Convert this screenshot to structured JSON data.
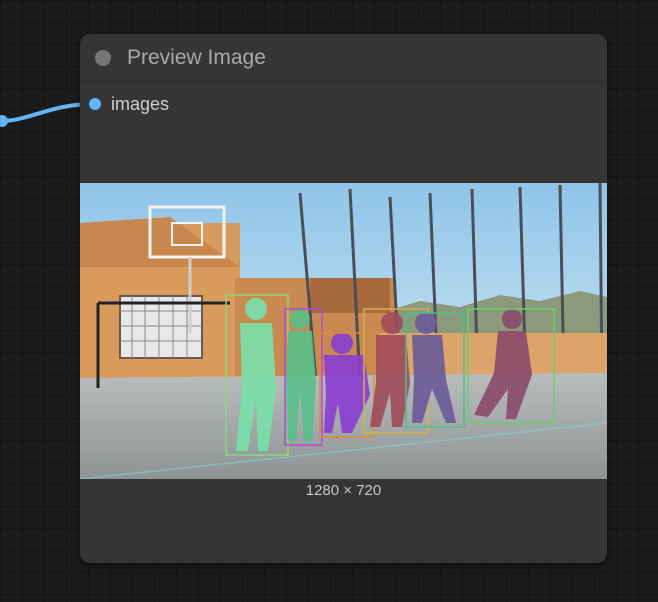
{
  "node": {
    "title": "Preview Image",
    "input_label": "images",
    "resolution": "1280 × 720"
  },
  "colors": {
    "canvas_bg": "#1b1b1b",
    "node_bg": "#353535",
    "wire": "#64b5f6",
    "slot": "#64b5f6",
    "title_text": "#a8a8a8"
  },
  "detections": [
    {
      "label": "person",
      "color": "#79e0a8",
      "outline": "#8fd67a"
    },
    {
      "label": "person",
      "color": "#58c08a",
      "outline": "#b04bd6"
    },
    {
      "label": "person",
      "color": "#8a3fd0",
      "outline": "#e08a3a"
    },
    {
      "label": "person",
      "color": "#a04a5a",
      "outline": "#d2b04a"
    },
    {
      "label": "person",
      "color": "#6a5a9a",
      "outline": "#4ac090"
    },
    {
      "label": "person",
      "color": "#8a4a6a",
      "outline": "#6ad06a"
    }
  ]
}
